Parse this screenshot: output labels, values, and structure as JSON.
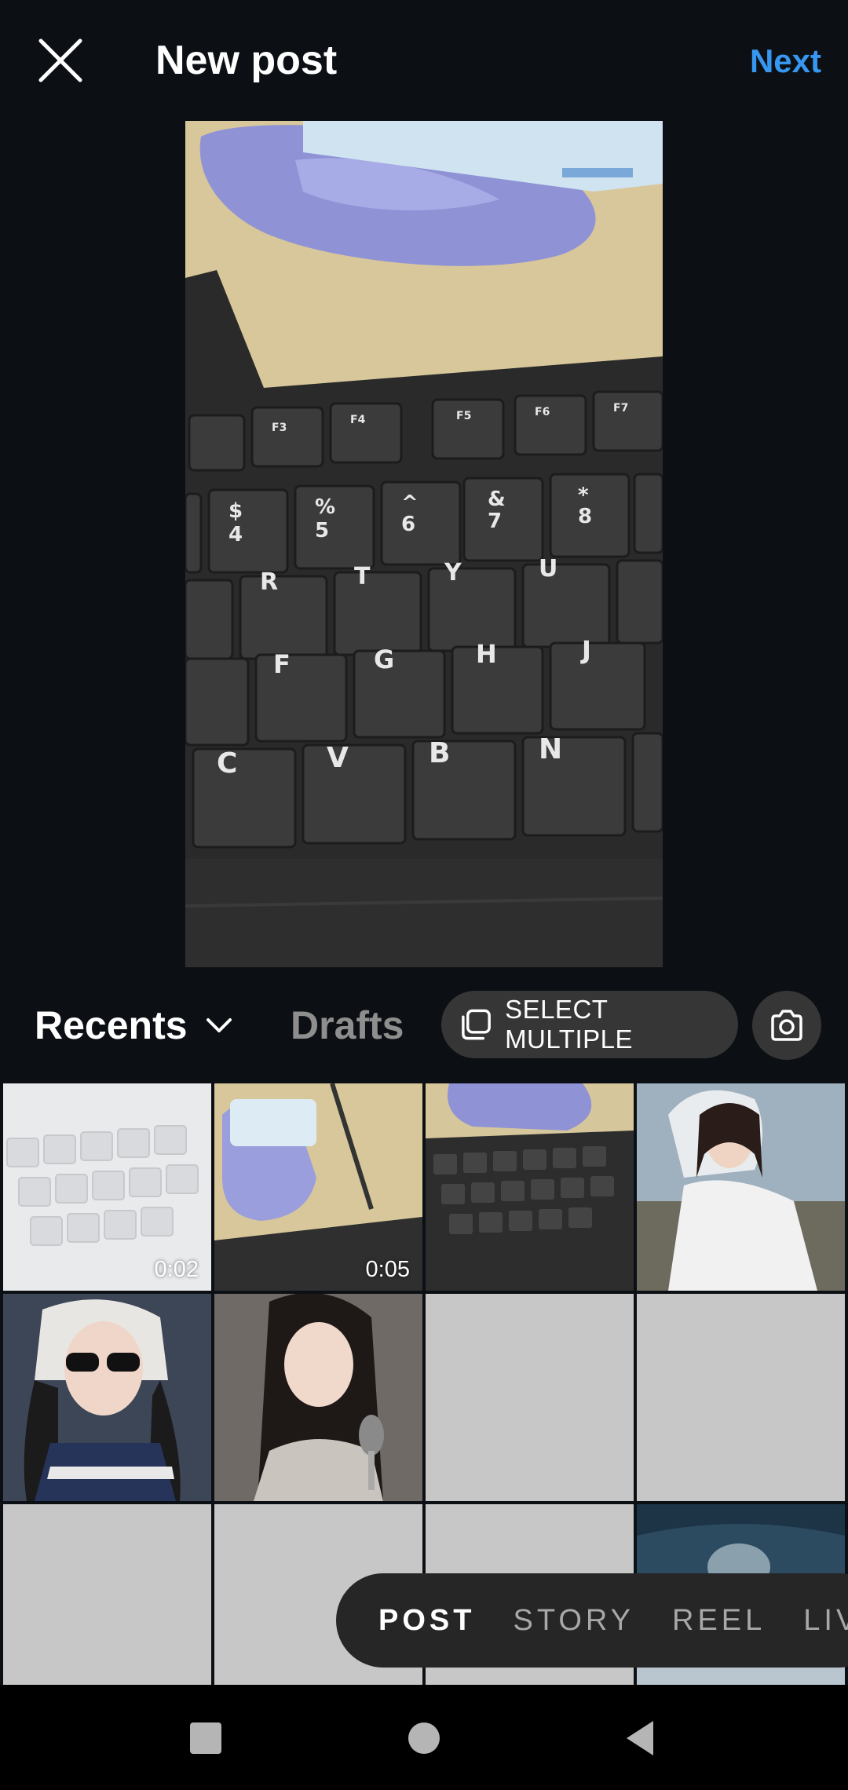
{
  "header": {
    "title": "New post",
    "next_label": "Next"
  },
  "toolbar": {
    "album_label": "Recents",
    "drafts_label": "Drafts",
    "select_multiple_label": "SELECT MULTIPLE"
  },
  "grid": {
    "durations": [
      "0:02",
      "0:05"
    ]
  },
  "modes": [
    "POST",
    "STORY",
    "REEL",
    "LIVE"
  ],
  "colors": {
    "accent": "#3797f0",
    "background": "#0c1014",
    "placeholder": "#c7c7c7"
  }
}
